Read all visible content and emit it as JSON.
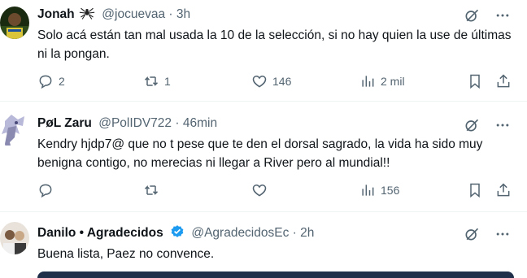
{
  "tweets": [
    {
      "name": "Jonah",
      "handle": "@jocuevaa",
      "dot": "·",
      "time": "3h",
      "text": "Solo acá están tan mal usada la 10 de la selección, si no hay quien la use de últimas ni la pongan.",
      "replies": "2",
      "retweets": "1",
      "likes": "146",
      "views": "2 mil"
    },
    {
      "name": "PøL Zaru",
      "handle": "@PolIDV722",
      "dot": "·",
      "time": "46min",
      "text": "Kendry hjdp7@ que no t pese que te den el dorsal sagrado, la vida ha sido muy benigna contigo, no merecias ni llegar a River pero al mundial!!",
      "replies": "",
      "retweets": "",
      "likes": "",
      "views": "156"
    },
    {
      "name": "Danilo • Agradecidos",
      "handle": "@AgradecidosEc",
      "dot": "·",
      "time": "2h",
      "text": "Buena lista, Paez no convence."
    }
  ],
  "icons": {
    "grok": "grok-icon",
    "more": "more-icon",
    "reply": "reply-icon",
    "retweet": "retweet-icon",
    "like": "like-icon",
    "views": "views-icon",
    "bookmark": "bookmark-icon",
    "share": "share-icon",
    "verified": "verified-badge-icon",
    "spider": "spider-emoji-icon"
  },
  "colors": {
    "text": "#0f1419",
    "secondary": "#536471",
    "verified": "#1d9bf0",
    "divider": "#eff3f4"
  }
}
